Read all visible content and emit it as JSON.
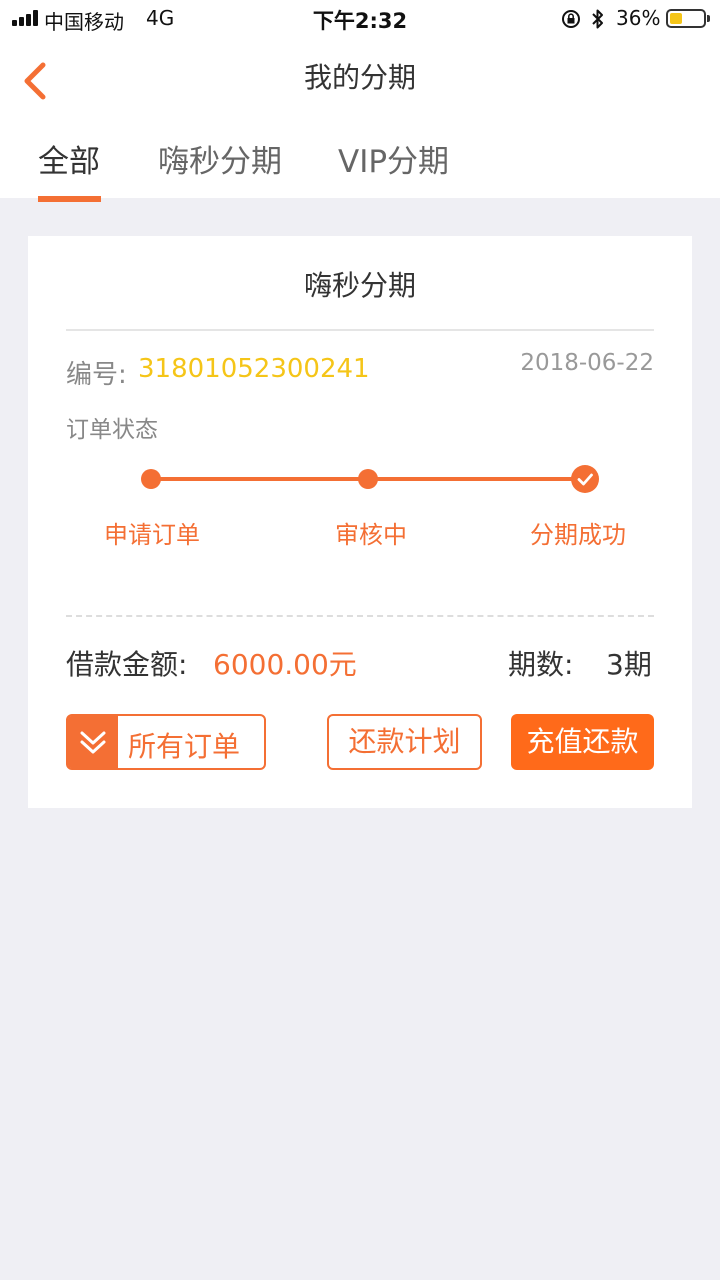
{
  "status_bar": {
    "carrier": "中国移动",
    "network": "4G",
    "time": "下午2:32",
    "battery_percent": "36%",
    "battery_level": 0.36
  },
  "nav": {
    "title": "我的分期",
    "back_icon": "chevron-left-icon"
  },
  "tabs": [
    {
      "label": "全部",
      "active": true
    },
    {
      "label": "嗨秒分期",
      "active": false
    },
    {
      "label": "VIP分期",
      "active": false
    }
  ],
  "card": {
    "title": "嗨秒分期",
    "order_label": "编号:",
    "order_number": "31801052300241",
    "date": "2018-06-22",
    "status_label": "订单状态",
    "steps": [
      {
        "label": "申请订单"
      },
      {
        "label": "审核中"
      },
      {
        "label": "分期成功"
      }
    ],
    "amount_label": "借款金额:",
    "amount_value": "6000.00元",
    "periods_label": "期数:",
    "periods_value": "3期",
    "buttons": {
      "all_orders": "所有订单",
      "repay_plan": "还款计划",
      "recharge_repay": "充值还款"
    }
  },
  "colors": {
    "accent": "#f46f34",
    "order_number": "#f5c518",
    "background": "#efeff4"
  }
}
